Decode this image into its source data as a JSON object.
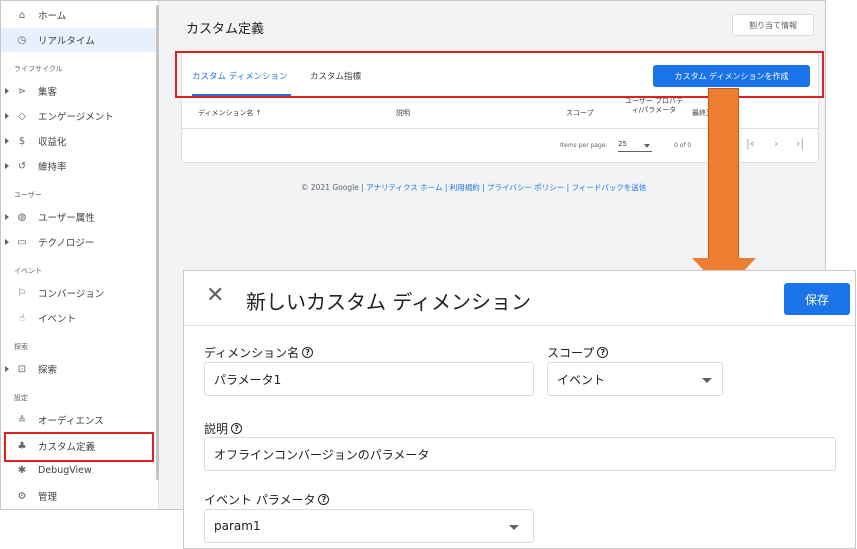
{
  "sidebar": {
    "items": [
      {
        "label": "ホーム",
        "icon": "home-icon",
        "glyph": "⌂"
      },
      {
        "label": "リアルタイム",
        "icon": "clock-icon",
        "glyph": "◷"
      },
      {
        "label": "集客",
        "icon": "acquisition-icon",
        "glyph": "⋗"
      },
      {
        "label": "エンゲージメント",
        "icon": "tag-icon",
        "glyph": "◇"
      },
      {
        "label": "収益化",
        "icon": "dollar-icon",
        "glyph": "$"
      },
      {
        "label": "維持率",
        "icon": "retention-icon",
        "glyph": "↺"
      },
      {
        "label": "ユーザー属性",
        "icon": "globe-icon",
        "glyph": "◍"
      },
      {
        "label": "テクノロジー",
        "icon": "devices-icon",
        "glyph": "▭"
      },
      {
        "label": "コンバージョン",
        "icon": "flag-icon",
        "glyph": "⚐"
      },
      {
        "label": "イベント",
        "icon": "touch-icon",
        "glyph": "☝"
      },
      {
        "label": "探索",
        "icon": "explore-icon",
        "glyph": "⊡"
      },
      {
        "label": "オーディエンス",
        "icon": "audience-icon",
        "glyph": "≗"
      },
      {
        "label": "カスタム定義",
        "icon": "shapes-icon",
        "glyph": "♣"
      },
      {
        "label": "DebugView",
        "icon": "bug-icon",
        "glyph": "✱"
      },
      {
        "label": "管理",
        "icon": "gear-icon",
        "glyph": "⚙"
      }
    ],
    "sections": {
      "lifecycle": "ライフサイクル",
      "user": "ユーザー",
      "event": "イベント",
      "explore": "探索",
      "config": "設定"
    }
  },
  "page": {
    "title": "カスタム定義",
    "assign_button": "割り当て情報",
    "tabs": [
      "カスタム ディメンション",
      "カスタム指標"
    ],
    "create_button": "カスタム ディメンションを作成",
    "table_headers": {
      "name": "ディメンション名 ↑",
      "description": "説明",
      "scope": "スコープ",
      "user_property": "ユーザー プロパティ/パラメータ",
      "last_changed": "最終変更日"
    },
    "pager": {
      "items_per_page_label": "Items per page:",
      "items_per_page": "25",
      "range": "0 of 0"
    },
    "footer": {
      "copyright": "© 2021 Google |",
      "links": "アナリティクス ホーム | 利用規約 | プライバシー ポリシー | フィードバックを送信"
    }
  },
  "dialog": {
    "title": "新しいカスタム ディメンション",
    "save_button": "保存",
    "dimension_name_label": "ディメンション名",
    "dimension_name_value": "パラメータ1",
    "scope_label": "スコープ",
    "scope_value": "イベント",
    "description_label": "説明",
    "description_value": "オフラインコンバージョンのパラメータ",
    "event_param_label": "イベント パラメータ",
    "event_param_value": "param1"
  },
  "colors": {
    "accent": "#1a73e8",
    "highlight_red": "#e02020",
    "arrow_orange": "#ed7d31"
  }
}
